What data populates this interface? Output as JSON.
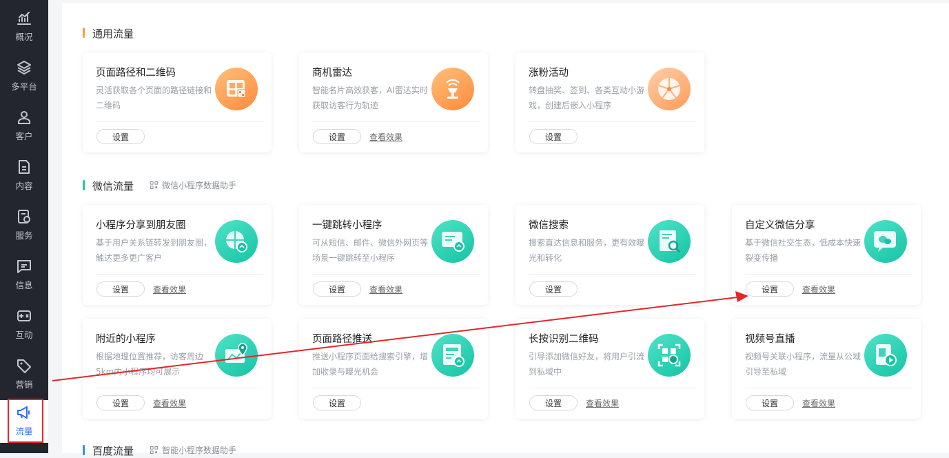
{
  "sidebar": {
    "items": [
      {
        "label": "概况",
        "icon": "chart-icon"
      },
      {
        "label": "多平台",
        "icon": "layers-icon"
      },
      {
        "label": "客户",
        "icon": "user-icon"
      },
      {
        "label": "内容",
        "icon": "document-icon"
      },
      {
        "label": "服务",
        "icon": "service-icon"
      },
      {
        "label": "信息",
        "icon": "message-icon"
      },
      {
        "label": "互动",
        "icon": "interact-icon"
      },
      {
        "label": "营销",
        "icon": "tag-icon"
      },
      {
        "label": "流量",
        "icon": "megaphone-icon"
      }
    ],
    "active": "流量",
    "accent": "#2f6bff"
  },
  "sections": {
    "general": {
      "title": "通用流量",
      "color": "#ff9a3c"
    },
    "wechat": {
      "title": "微信流量",
      "subtitle": "微信小程序数据助手",
      "color": "#1fc7a8"
    },
    "baidu": {
      "title": "百度流量",
      "subtitle": "智能小程序数据助手",
      "color": "#2f8cff"
    }
  },
  "buttons": {
    "settings": "设置",
    "view_effect": "查看效果"
  },
  "cards": {
    "general": [
      {
        "title": "页面路径和二维码",
        "desc": "灵活获取各个页面的路径链接和二维码",
        "icon": "qrcode-page-icon",
        "effect": false
      },
      {
        "title": "商机雷达",
        "desc": "智能名片高效获客，AI雷达实时获取访客行为轨迹",
        "icon": "radar-icon",
        "effect": true
      },
      {
        "title": "涨粉活动",
        "desc": "转盘抽奖、签到、各类互动小游戏，创建后嵌入小程序",
        "icon": "wheel-icon",
        "effect": false
      }
    ],
    "wechat_row1": [
      {
        "title": "小程序分享到朋友圈",
        "desc": "基于用户关系链转发到朋友圈，触达更多更广客户",
        "icon": "moments-icon",
        "effect": true
      },
      {
        "title": "一键跳转小程序",
        "desc": "可从短信、邮件、微信外网页等场景一键跳转至小程序",
        "icon": "jump-icon",
        "effect": true
      },
      {
        "title": "微信搜索",
        "desc": "搜索直达信息和服务，更有效曝光和转化",
        "icon": "search-icon",
        "effect": false
      },
      {
        "title": "自定义微信分享",
        "desc": "基于微信社交生态，低成本快速裂变传播",
        "icon": "wechat-share-icon",
        "effect": true
      }
    ],
    "wechat_row2": [
      {
        "title": "附近的小程序",
        "desc": "根据地理位置推荐，访客周边5km内小程序均可展示",
        "icon": "map-icon",
        "effect": true
      },
      {
        "title": "页面路径推送",
        "desc": "推送小程序页面给搜索引擎，增加收录与曝光机会",
        "icon": "push-icon",
        "effect": false
      },
      {
        "title": "长按识别二维码",
        "desc": "引导添加微信好友，将用户引流到私域中",
        "icon": "qrcode-scan-icon",
        "effect": true
      },
      {
        "title": "视频号直播",
        "desc": "视频号关联小程序，流量从公域引导至私域",
        "icon": "video-live-icon",
        "effect": true
      }
    ]
  },
  "annotation": {
    "arrow_color": "#e4262a",
    "highlight_color": "#e4262a"
  }
}
